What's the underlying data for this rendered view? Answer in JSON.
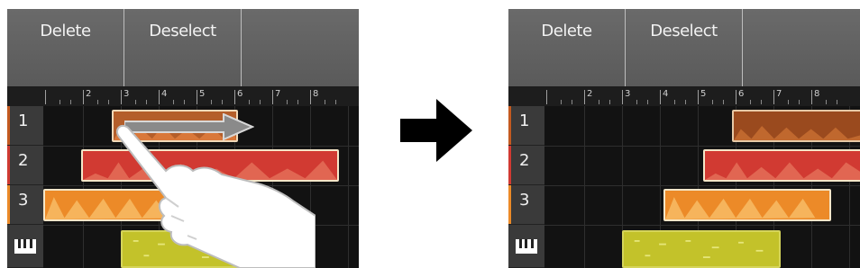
{
  "before": {
    "toolbar": {
      "buttons": [
        "Delete",
        "Deselect"
      ]
    },
    "ruler": {
      "numbers": [
        "2",
        "3",
        "4",
        "5",
        "6",
        "7",
        "8"
      ]
    },
    "tracks": [
      "1",
      "2",
      "3"
    ]
  },
  "after": {
    "toolbar": {
      "buttons": [
        "Delete",
        "Deselect"
      ]
    },
    "ruler": {
      "numbers": [
        "2",
        "3",
        "4",
        "5",
        "6",
        "7",
        "8"
      ]
    },
    "tracks": [
      "1",
      "2",
      "3"
    ]
  },
  "icons": {
    "transition": "arrow-right-icon",
    "gesture": "hand-drag-icon",
    "drag_direction": "arrow-right-icon",
    "rhythm_track": "piano-keys-icon"
  },
  "colors": {
    "track1": "#b45e2a",
    "track2": "#d13a32",
    "track3": "#ec8a28",
    "rhythm": "#c3c22a",
    "region_border": "#f4e6c8"
  }
}
